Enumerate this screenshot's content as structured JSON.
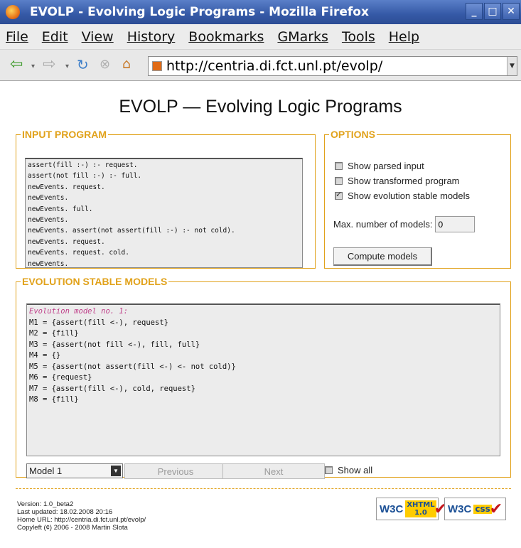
{
  "window": {
    "title": "EVOLP - Evolving Logic Programs - Mozilla Firefox",
    "controls": [
      "_",
      "□",
      "✕"
    ]
  },
  "menu": [
    "File",
    "Edit",
    "View",
    "History",
    "Bookmarks",
    "GMarks",
    "Tools",
    "Help"
  ],
  "address": {
    "url": "http://centria.di.fct.unl.pt/evolp/"
  },
  "page": {
    "title": "EVOLP — Evolving Logic Programs",
    "input": {
      "legend": "INPUT PROGRAM",
      "program": "assert(fill :-) :- request.\nassert(not fill :-) :- full.\nnewEvents. request.\nnewEvents.\nnewEvents. full.\nnewEvents.\nnewEvents. assert(not assert(fill :-) :- not cold).\nnewEvents. request.\nnewEvents. request. cold.\nnewEvents."
    },
    "options": {
      "legend": "OPTIONS",
      "checks": [
        {
          "label": "Show parsed input",
          "checked": false
        },
        {
          "label": "Show transformed program",
          "checked": false
        },
        {
          "label": "Show evolution stable models",
          "checked": true
        }
      ],
      "max_label": "Max. number of models:",
      "max_value": "0",
      "compute_label": "Compute models"
    },
    "results": {
      "legend": "EVOLUTION STABLE MODELS",
      "heading": "Evolution model no. 1:",
      "models": [
        "M1 = {assert(fill <-), request}",
        "M2 = {fill}",
        "M3 = {assert(not fill <-), fill, full}",
        "M4 = {}",
        "M5 = {assert(not assert(fill <-) <- not cold)}",
        "M6 = {request}",
        "M7 = {assert(fill <-), cold, request}",
        "M8 = {fill}"
      ],
      "select_value": "Model 1",
      "prev_label": "Previous",
      "next_label": "Next",
      "showall_label": "Show all"
    },
    "footer": {
      "version": "Version: 1.0_beta2",
      "updated": "Last updated: 18.02.2008 20:16",
      "home": "Home URL: http://centria.di.fct.unl.pt/evolp/",
      "copyleft": "Copyleft (¢) 2006 - 2008 Martin Slota"
    },
    "badges": {
      "w3c": "W3C",
      "xhtml": "XHTML 1.0",
      "css": "css"
    }
  }
}
